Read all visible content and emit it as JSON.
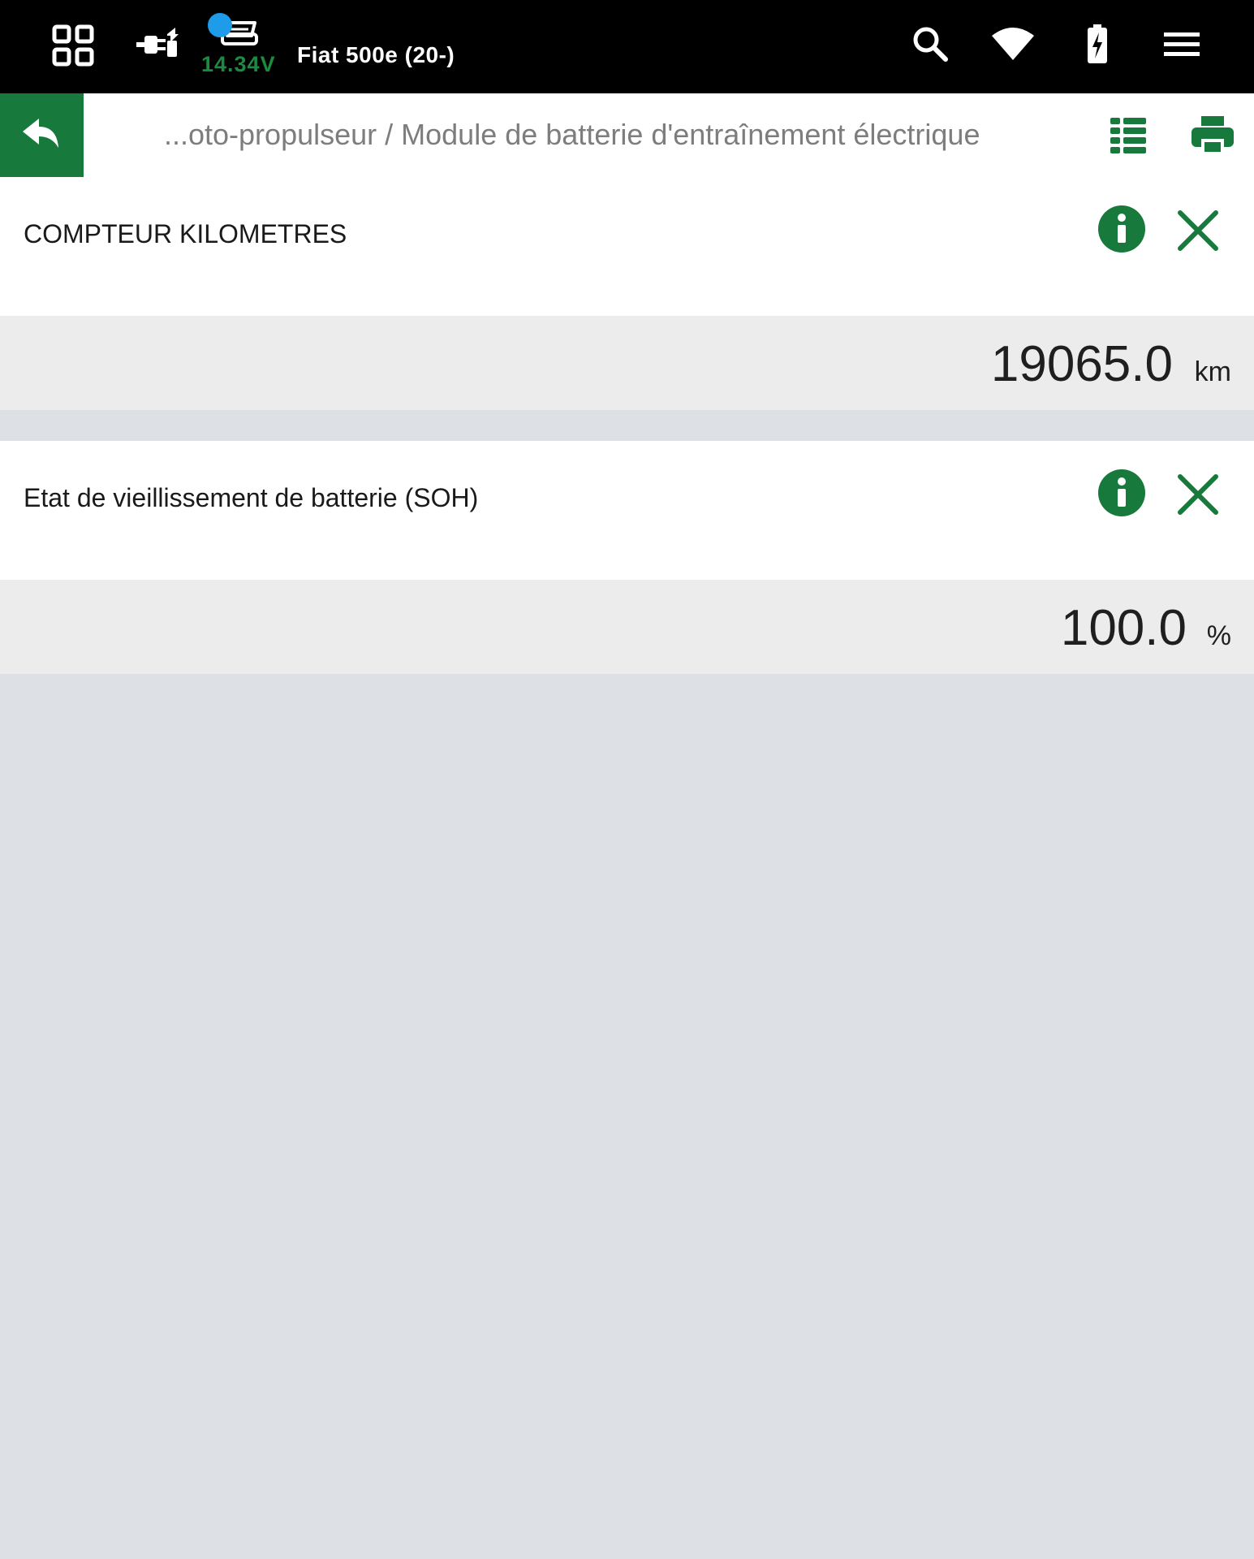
{
  "topbar": {
    "icons": [
      "grid-icon",
      "plug-icon",
      "car-icon",
      "search-icon",
      "wifi-icon",
      "battery-charging-icon",
      "menu-icon"
    ],
    "voltage": "14.34V",
    "vehicle": "Fiat 500e (20-)",
    "colors": {
      "background": "#000000",
      "voltage": "#1c8a3f",
      "status_dot": "#1e9be9"
    }
  },
  "crumbbar": {
    "back_icon": "reply-back-icon",
    "breadcrumb": "...oto-propulseur / Module de batterie d'entraînement électrique",
    "list_icon": "list-view-icon",
    "print_icon": "print-icon",
    "accent": "#177a3c"
  },
  "params": [
    {
      "label": "COMPTEUR KILOMETRES",
      "value": "19065.0",
      "unit": "km",
      "info_icon": "info-icon",
      "close_icon": "close-icon"
    },
    {
      "label": "Etat de vieillissement de batterie (SOH)",
      "value": "100.0",
      "unit": "%",
      "info_icon": "info-icon",
      "close_icon": "close-icon"
    }
  ]
}
